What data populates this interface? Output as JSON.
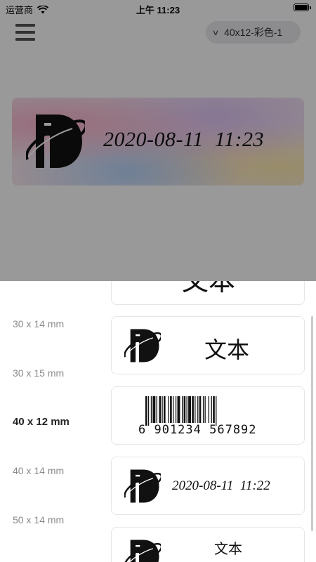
{
  "status_bar": {
    "carrier": "运营商",
    "time": "上午 11:23"
  },
  "header": {
    "template_selector": "40x12-彩色-1"
  },
  "preview": {
    "date_text": "2020-08-11  11:23"
  },
  "sizes": [
    {
      "label": "30 x 14 mm",
      "active": false
    },
    {
      "label": "30 x 15 mm",
      "active": false
    },
    {
      "label": "40 x 12 mm",
      "active": true
    },
    {
      "label": "40 x 14 mm",
      "active": false
    },
    {
      "label": "50 x 14 mm",
      "active": false
    }
  ],
  "templates": {
    "card1_text": "文本",
    "card2_text": "文本",
    "barcode_digits": "6 901234 567892",
    "card4_date": "2020-08-11  11:22",
    "card5_text": "文本"
  },
  "colors": {
    "accent_pill": "#e9e9ee",
    "overlay": "rgba(0,0,0,0.4)"
  }
}
